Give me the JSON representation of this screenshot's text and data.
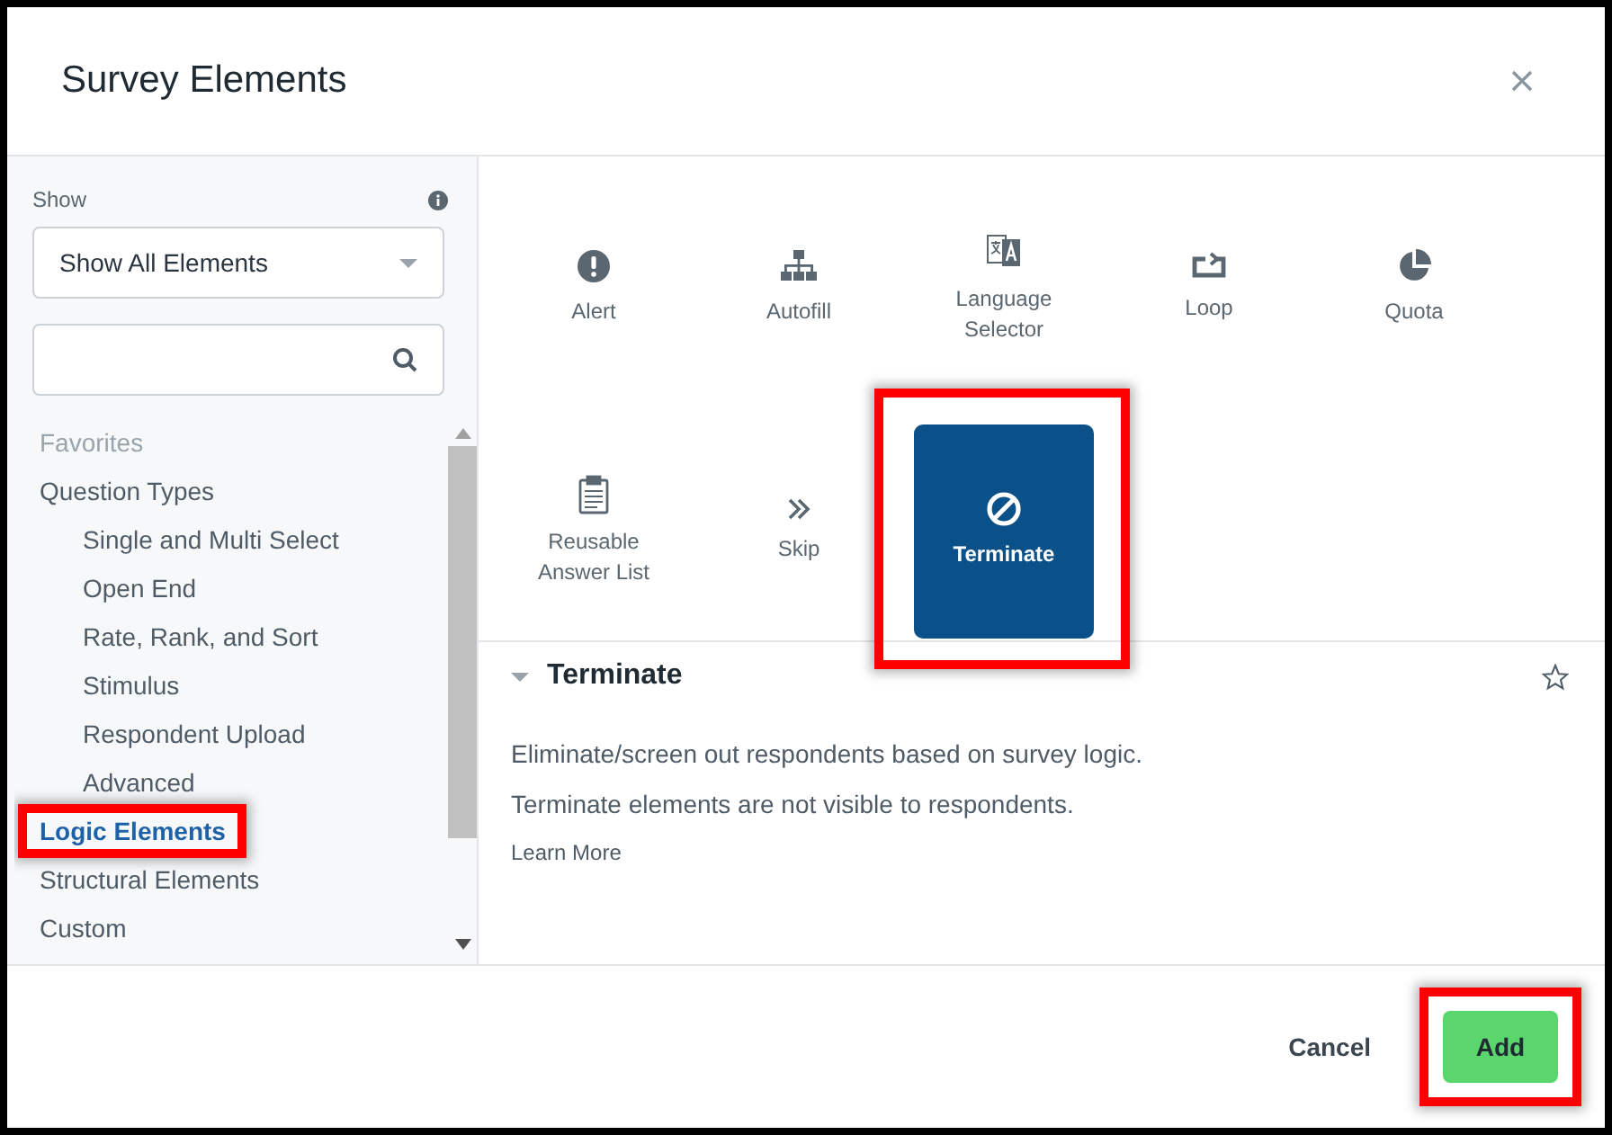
{
  "window": {
    "title": "Survey Elements"
  },
  "sidebar": {
    "show_label": "Show",
    "filter": {
      "value": "Show All Elements"
    },
    "categories": [
      {
        "label": "Favorites",
        "disabled": true,
        "selected": false,
        "highlighted": false
      },
      {
        "label": "Question Types",
        "disabled": false,
        "selected": false,
        "highlighted": false,
        "children": [
          {
            "label": "Single and Multi Select"
          },
          {
            "label": "Open End"
          },
          {
            "label": "Rate, Rank, and Sort"
          },
          {
            "label": "Stimulus"
          },
          {
            "label": "Respondent Upload"
          },
          {
            "label": "Advanced"
          }
        ]
      },
      {
        "label": "Logic Elements",
        "disabled": false,
        "selected": true,
        "highlighted": true
      },
      {
        "label": "Structural Elements",
        "disabled": false,
        "selected": false,
        "highlighted": false
      },
      {
        "label": "Custom",
        "disabled": false,
        "selected": false,
        "highlighted": false
      }
    ]
  },
  "elements": [
    {
      "label": "Alert",
      "kind": "alert",
      "selected": false,
      "highlighted": false
    },
    {
      "label": "Autofill",
      "kind": "autofill",
      "selected": false,
      "highlighted": false
    },
    {
      "label": "Language Selector",
      "kind": "language",
      "selected": false,
      "highlighted": false
    },
    {
      "label": "Loop",
      "kind": "loop",
      "selected": false,
      "highlighted": false
    },
    {
      "label": "Quota",
      "kind": "quota",
      "selected": false,
      "highlighted": false
    },
    {
      "label": "Reusable Answer List",
      "kind": "list",
      "selected": false,
      "highlighted": false
    },
    {
      "label": "Skip",
      "kind": "skip",
      "selected": false,
      "highlighted": false
    },
    {
      "label": "Terminate",
      "kind": "terminate",
      "selected": true,
      "highlighted": true
    }
  ],
  "detail": {
    "title": "Terminate",
    "expanded": true,
    "favorite": false,
    "paragraphs": [
      "Eliminate/screen out respondents based on survey logic.",
      "Terminate elements are not visible to respondents."
    ],
    "link": "Learn More"
  },
  "buttons": [
    {
      "label": "Cancel",
      "kind": "secondary",
      "highlighted": false
    },
    {
      "label": "Add",
      "kind": "primary",
      "highlighted": true
    }
  ]
}
